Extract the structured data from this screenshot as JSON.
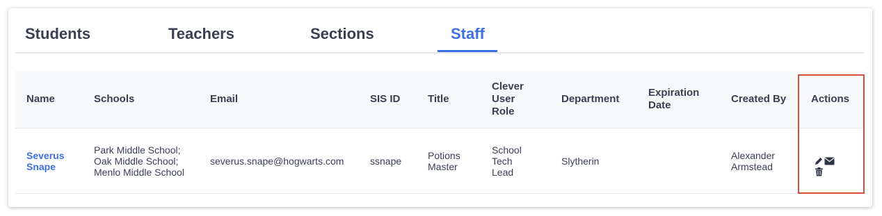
{
  "tabs": [
    {
      "label": "Students",
      "active": false
    },
    {
      "label": "Teachers",
      "active": false
    },
    {
      "label": "Sections",
      "active": false
    },
    {
      "label": "Staff",
      "active": true
    }
  ],
  "table": {
    "columns": [
      "Name",
      "Schools",
      "Email",
      "SIS ID",
      "Title",
      "Clever User Role",
      "Department",
      "Expiration Date",
      "Created By",
      "Actions"
    ],
    "rows": [
      {
        "name": "Severus Snape",
        "schools": "Park Middle School; Oak Middle School; Menlo Middle School",
        "email": "severus.snape@hogwarts.com",
        "sis_id": "ssnape",
        "title": "Potions Master",
        "clever_user_role": "School Tech Lead",
        "department": "Slytherin",
        "expiration_date": "",
        "created_by": "Alexander Armstead",
        "actions": [
          "pencil-icon",
          "envelope-icon",
          "trash-icon"
        ]
      }
    ]
  },
  "colors": {
    "accent": "#3d6fe0",
    "text": "#3a3f52",
    "highlight_border": "#d94f3d",
    "header_bg": "#f7f8fa"
  }
}
